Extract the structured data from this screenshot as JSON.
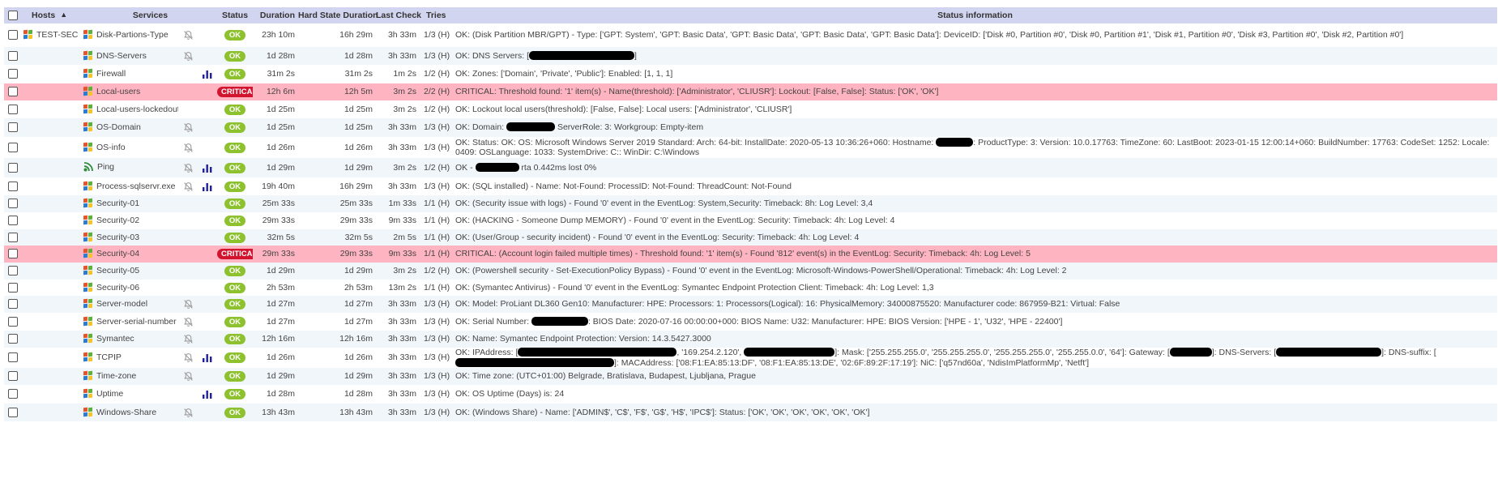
{
  "header": {
    "hosts": "Hosts",
    "services": "Services",
    "status": "Status",
    "duration": "Duration",
    "hard_state_duration": "Hard State Duration",
    "last_check": "Last Check",
    "tries": "Tries",
    "status_information": "Status information"
  },
  "host_name": "TEST-SEC",
  "rows": [
    {
      "service": "Disk-Partions-Type",
      "muted": true,
      "graph": false,
      "status": "OK",
      "duration": "23h 10m",
      "hard": "16h 29m",
      "last": "3h 33m",
      "tries": "1/3 (H)",
      "info": "OK: (Disk Partition MBR/GPT) - Type: ['GPT: System', 'GPT: Basic Data', 'GPT: Basic Data', 'GPT: Basic Data', 'GPT: Basic Data']: DeviceID: ['Disk #0, Partition #0', 'Disk #0, Partition #1', 'Disk #1, Partition #0', 'Disk #3, Partition #0', 'Disk #2, Partition #0']"
    },
    {
      "service": "DNS-Servers",
      "muted": true,
      "graph": false,
      "status": "OK",
      "duration": "1d 28m",
      "hard": "1d 28m",
      "last": "3h 33m",
      "tries": "1/3 (H)",
      "info_a": "OK: DNS Servers: [",
      "info_b": "]"
    },
    {
      "service": "Firewall",
      "muted": false,
      "graph": true,
      "status": "OK",
      "duration": "31m 2s",
      "hard": "31m 2s",
      "last": "1m 2s",
      "tries": "1/2 (H)",
      "info": "OK: Zones: ['Domain', 'Private', 'Public']: Enabled: [1, 1, 1]"
    },
    {
      "service": "Local-users",
      "muted": false,
      "graph": false,
      "status": "CRITICAL",
      "duration": "12h 6m",
      "hard": "12h 5m",
      "last": "3m 2s",
      "tries": "2/2 (H)",
      "info": "CRITICAL: Threshold found: '1' item(s) - Name(threshold): ['Administrator', 'CLIUSR']: Lockout: [False, False]: Status: ['OK', 'OK']"
    },
    {
      "service": "Local-users-lockedout",
      "muted": false,
      "graph": false,
      "status": "OK",
      "duration": "1d 25m",
      "hard": "1d 25m",
      "last": "3m 2s",
      "tries": "1/2 (H)",
      "info": "OK: Lockout local users(threshold): [False, False]: Local users: ['Administrator', 'CLIUSR']"
    },
    {
      "service": "OS-Domain",
      "muted": true,
      "graph": false,
      "status": "OK",
      "duration": "1d 25m",
      "hard": "1d 25m",
      "last": "3h 33m",
      "tries": "1/3 (H)",
      "info_a": "OK: Domain: ",
      "info_b": " ServerRole: 3: Workgroup: Empty-item"
    },
    {
      "service": "OS-info",
      "muted": true,
      "graph": false,
      "status": "OK",
      "duration": "1d 26m",
      "hard": "1d 26m",
      "last": "3h 33m",
      "tries": "1/3 (H)",
      "info_a": "OK: Status: OK: OS: Microsoft Windows Server 2019 Standard: Arch: 64-bit: InstallDate: 2020-05-13 10:36:26+060: Hostname: ",
      "info_b": ": ProductType: 3: Version: 10.0.17763: TimeZone: 60: LastBoot: 2023-01-15 12:00:14+060: BuildNumber: 17763: CodeSet: 1252: Locale: 0409: OSLanguage: 1033: SystemDrive: C:: WinDir: C:\\Windows"
    },
    {
      "service": "Ping",
      "muted": true,
      "graph": true,
      "status": "OK",
      "duration": "1d 29m",
      "hard": "1d 29m",
      "last": "3m 2s",
      "tries": "1/2 (H)",
      "info_a": "OK - ",
      "info_b": " rta 0.442ms lost 0%"
    },
    {
      "service": "Process-sqlservr.exe",
      "muted": true,
      "graph": true,
      "status": "OK",
      "duration": "19h 40m",
      "hard": "16h 29m",
      "last": "3h 33m",
      "tries": "1/3 (H)",
      "info": "OK: (SQL installed) - Name: Not-Found: ProcessID: Not-Found: ThreadCount: Not-Found"
    },
    {
      "service": "Security-01",
      "muted": false,
      "graph": false,
      "status": "OK",
      "duration": "25m 33s",
      "hard": "25m 33s",
      "last": "1m 33s",
      "tries": "1/1 (H)",
      "info": "OK: (Security issue with logs) - Found '0' event in the EventLog: System,Security: Timeback: 8h: Log Level: 3,4"
    },
    {
      "service": "Security-02",
      "muted": false,
      "graph": false,
      "status": "OK",
      "duration": "29m 33s",
      "hard": "29m 33s",
      "last": "9m 33s",
      "tries": "1/1 (H)",
      "info": "OK: (HACKING - Someone Dump MEMORY) - Found '0' event in the EventLog: Security: Timeback: 4h: Log Level: 4"
    },
    {
      "service": "Security-03",
      "muted": false,
      "graph": false,
      "status": "OK",
      "duration": "32m 5s",
      "hard": "32m 5s",
      "last": "2m 5s",
      "tries": "1/1 (H)",
      "info": "OK: (User/Group - security incident) - Found '0' event in the EventLog: Security: Timeback: 4h: Log Level: 4"
    },
    {
      "service": "Security-04",
      "muted": false,
      "graph": false,
      "status": "CRITICAL",
      "duration": "29m 33s",
      "hard": "29m 33s",
      "last": "9m 33s",
      "tries": "1/1 (H)",
      "info": "CRITICAL: (Account login failed multiple times) - Threshold found: '1' item(s) - Found '812' event(s) in the EventLog: Security: Timeback: 4h: Log Level: 5"
    },
    {
      "service": "Security-05",
      "muted": false,
      "graph": false,
      "status": "OK",
      "duration": "1d 29m",
      "hard": "1d 29m",
      "last": "3m 2s",
      "tries": "1/2 (H)",
      "info": "OK: (Powershell security - Set-ExecutionPolicy Bypass) - Found '0' event in the EventLog: Microsoft-Windows-PowerShell/Operational: Timeback: 4h: Log Level: 2"
    },
    {
      "service": "Security-06",
      "muted": false,
      "graph": false,
      "status": "OK",
      "duration": "2h 53m",
      "hard": "2h 53m",
      "last": "13m 2s",
      "tries": "1/1 (H)",
      "info": "OK: (Symantec Antivirus) - Found '0' event in the EventLog: Symantec Endpoint Protection Client: Timeback: 4h: Log Level: 1,3"
    },
    {
      "service": "Server-model",
      "muted": true,
      "graph": false,
      "status": "OK",
      "duration": "1d 27m",
      "hard": "1d 27m",
      "last": "3h 33m",
      "tries": "1/3 (H)",
      "info": "OK: Model: ProLiant DL360 Gen10: Manufacturer: HPE: Processors: 1: Processors(Logical): 16: PhysicalMemory: 34000875520: Manufacturer code: 867959-B21: Virtual: False"
    },
    {
      "service": "Server-serial-number",
      "muted": true,
      "graph": false,
      "status": "OK",
      "duration": "1d 27m",
      "hard": "1d 27m",
      "last": "3h 33m",
      "tries": "1/3 (H)",
      "info_a": "OK: Serial Number: ",
      "info_b": ": BIOS Date: 2020-07-16 00:00:00+000: BIOS Name: U32: Manufacturer: HPE: BIOS Version: ['HPE - 1', 'U32', 'HPE - 22400']"
    },
    {
      "service": "Symantec",
      "muted": true,
      "graph": false,
      "status": "OK",
      "duration": "12h 16m",
      "hard": "12h 16m",
      "last": "3h 33m",
      "tries": "1/3 (H)",
      "info": "OK: Name: Symantec Endpoint Protection: Version: 14.3.5427.3000"
    },
    {
      "service": "TCPIP",
      "muted": true,
      "graph": true,
      "status": "OK",
      "duration": "1d 26m",
      "hard": "1d 26m",
      "last": "3h 33m",
      "tries": "1/3 (H)",
      "info_a": "OK: IPAddress: [",
      "info_b": ", '169.254.2.120', ",
      "info_c": "]: Mask: ['255.255.255.0', '255.255.255.0', '255.255.255.0', '255.255.0.0', '64']: Gateway: [",
      "info_d": "]: DNS-Servers: [",
      "info_e": "]: DNS-suffix: [",
      "info_f": "]: MACAddress: ['08:F1:EA:85:13:DF', '08:F1:EA:85:13:DE', '02:6F:89:2F:17:19']: NiC: ['q57nd60a', 'NdisImPlatformMp', 'Netft']"
    },
    {
      "service": "Time-zone",
      "muted": true,
      "graph": false,
      "status": "OK",
      "duration": "1d 29m",
      "hard": "1d 29m",
      "last": "3h 33m",
      "tries": "1/3 (H)",
      "info": "OK: Time zone: (UTC+01:00) Belgrade, Bratislava, Budapest, Ljubljana, Prague"
    },
    {
      "service": "Uptime",
      "muted": false,
      "graph": true,
      "status": "OK",
      "duration": "1d 28m",
      "hard": "1d 28m",
      "last": "3h 33m",
      "tries": "1/3 (H)",
      "info": "OK: OS Uptime (Days) is: 24"
    },
    {
      "service": "Windows-Share",
      "muted": true,
      "graph": false,
      "status": "OK",
      "duration": "13h 43m",
      "hard": "13h 43m",
      "last": "3h 33m",
      "tries": "1/3 (H)",
      "info": "OK: (Windows Share) - Name: ['ADMIN$', 'C$', 'F$', 'G$', 'H$', 'IPC$']: Status: ['OK', 'OK', 'OK', 'OK', 'OK', 'OK']"
    }
  ],
  "icons": {
    "os": "windows-logo-icon",
    "ping": "ping-signal-icon",
    "muted": "notifications-off-icon",
    "graph": "performance-graph-icon",
    "sort": "sort-ascending-icon"
  },
  "colors": {
    "ok": "#8dc12e",
    "critical": "#d2142f",
    "critical_row": "#ffb4c1",
    "header": "#d2d5ef",
    "graph": "#1f1fa0"
  }
}
